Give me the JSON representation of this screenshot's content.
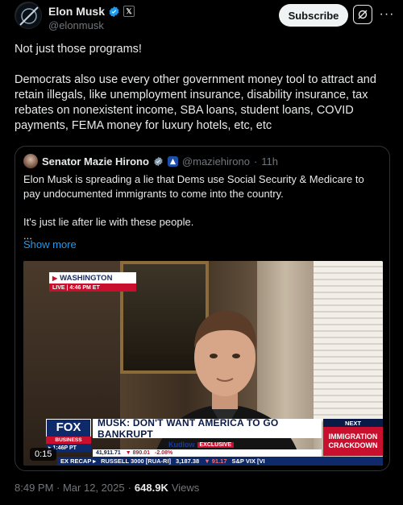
{
  "author": {
    "name": "Elon Musk",
    "handle": "@elonmusk",
    "affiliate_badge": "𝕏"
  },
  "actions": {
    "subscribe_label": "Subscribe",
    "more_label": "···"
  },
  "post": {
    "text": "Not just those programs!\n\nDemocrats also use every other government money tool to attract and retain illegals, like unemployment insurance, disability insurance, tax rebates on nonexistent income, SBA loans, student loans, COVID payments, FEMA money for luxury hotels, etc, etc"
  },
  "quote": {
    "name": "Senator Mazie Hirono",
    "handle": "@maziehirono",
    "separator": "·",
    "age": "11h",
    "text": "Elon Musk is spreading a lie that Dems use Social Security & Medicare to pay undocumented immigrants to come into the country.\n\nIt's just lie after lie with these people.\n...",
    "show_more": "Show more"
  },
  "video": {
    "location": "WASHINGTON",
    "live": "LIVE | 4:46 PM ET",
    "network": "FOX",
    "network_sub": "BUSINESS",
    "headline": "MUSK: DON'T WANT AMERICA TO GO BANKRUPT",
    "time": "▸ 1:46P PT",
    "show": "Kudlow",
    "show_tag": "EXCLUSIVE",
    "ticker1_a": "41,911.71",
    "ticker1_b": "▼ 890.01",
    "ticker1_c": "-2.08%",
    "ticker2_a": "EX RECAP ▸",
    "ticker2_b": "RUSSELL 3000 [RUA-RI]",
    "ticker2_c": "3,187.38",
    "ticker2_d": "▼ 91.17",
    "ticker2_e": "S&P VIX [VI",
    "next_label": "NEXT",
    "next_topic_1": "IMMIGRATION",
    "next_topic_2": "CRACKDOWN",
    "timer": "0:15"
  },
  "footer": {
    "time": "8:49 PM · Mar 12, 2025",
    "separator": "·",
    "views": "648.9K",
    "views_label": "Views"
  },
  "colors": {
    "accent": "#1d9bf0",
    "fox_blue": "#0f2a6b",
    "fox_red": "#c8102e"
  }
}
